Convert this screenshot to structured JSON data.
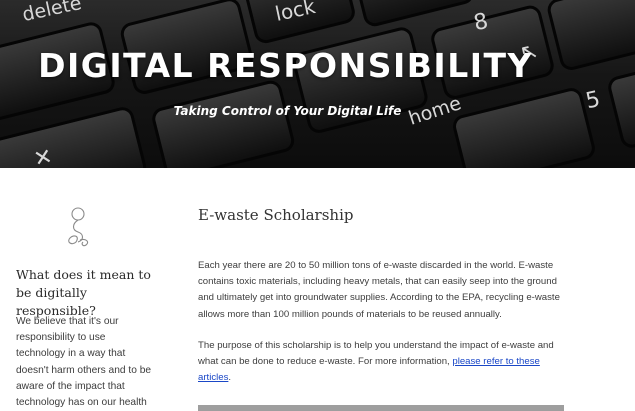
{
  "header": {
    "title": "DIGITAL RESPONSIBILITY",
    "tagline": "Taking Control of Your Digital Life",
    "keys": {
      "delete": "delete",
      "lock": "lock",
      "eight": "8",
      "home": "home",
      "five": "5",
      "arrow": "↖",
      "x": "✕"
    }
  },
  "sidebar": {
    "logo_icon": "ornament-icon",
    "heading": "What does it mean to be digitally responsible?",
    "body": "We believe that it's our responsibility to use technology in a way that doesn't harm others and to be aware of the impact that technology has on our health"
  },
  "main": {
    "title": "E-waste Scholarship",
    "paragraph1": "Each year there are 20 to 50 million tons of e-waste discarded in the world. E-waste contains toxic materials, including heavy metals, that can easily seep into the ground and ultimately get into groundwater supplies. According to the EPA, recycling e-waste allows more than 100 million pounds of materials to be reused annually.",
    "paragraph2_text": "The purpose of this scholarship is to help you understand the impact of e-waste and what can be done to reduce e-waste. For more information, ",
    "paragraph2_link": "please refer to these articles",
    "paragraph2_end": "."
  },
  "colors": {
    "link": "#1a47c7",
    "text": "#3d3d3d",
    "banner_bg": "#161616"
  }
}
